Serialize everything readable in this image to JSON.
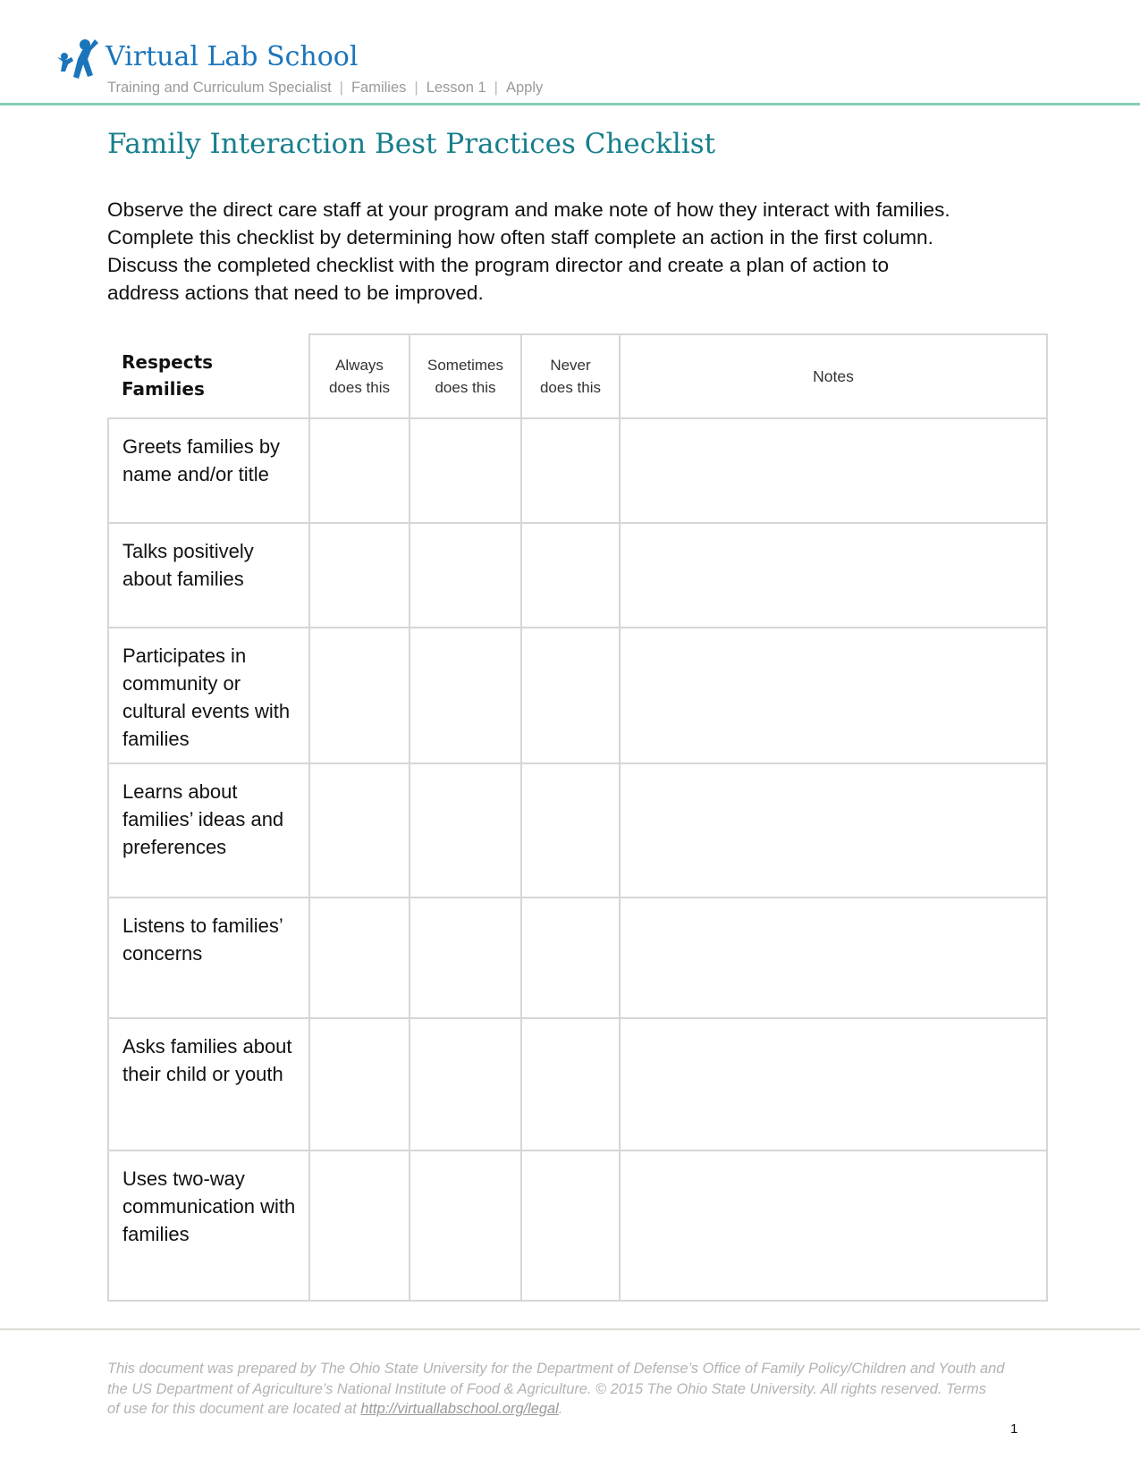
{
  "header": {
    "brand_name": "Virtual Lab School",
    "logo_icon": "people-jumping-icon",
    "breadcrumb": [
      "Training and Curriculum Specialist",
      "Families",
      "Lesson 1",
      "Apply"
    ],
    "breadcrumb_separator": "|"
  },
  "document": {
    "title": "Family Interaction Best Practices Checklist",
    "intro_lines": [
      "Observe the direct care staff at your program and make note of how they interact with families.",
      "Complete this checklist by determining how often staff complete an action in the first column.",
      "Discuss the completed checklist with the program director and create a plan of action to",
      "address actions that need to be improved."
    ]
  },
  "checklist": {
    "section_heading": "Respects Families",
    "columns": {
      "always": [
        "Always",
        "does this"
      ],
      "sometimes": [
        "Sometimes",
        "does this"
      ],
      "never": [
        "Never",
        "does this"
      ],
      "notes": "Notes"
    },
    "rows": [
      {
        "label": "Greets families by name and/or title",
        "always": "",
        "sometimes": "",
        "never": "",
        "notes": ""
      },
      {
        "label": "Talks positively about families",
        "always": "",
        "sometimes": "",
        "never": "",
        "notes": ""
      },
      {
        "label": "Participates in community or cultural events with families",
        "always": "",
        "sometimes": "",
        "never": "",
        "notes": ""
      },
      {
        "label": "Learns about families’ ideas and preferences",
        "always": "",
        "sometimes": "",
        "never": "",
        "notes": ""
      },
      {
        "label": "Listens to families’ concerns",
        "always": "",
        "sometimes": "",
        "never": "",
        "notes": ""
      },
      {
        "label": "Asks families about their child or youth",
        "always": "",
        "sometimes": "",
        "never": "",
        "notes": ""
      },
      {
        "label": "Uses two-way communication with families",
        "always": "",
        "sometimes": "",
        "never": "",
        "notes": ""
      }
    ]
  },
  "footer": {
    "note_line1": "This document was prepared by The Ohio State University for the Department of Defense’s Office of Family Policy/Children and Youth and",
    "note_line2": "the US Department of Agriculture’s National Institute of Food & Agriculture.  © 2015  The Ohio State University.  All rights reserved.  Terms",
    "note_line3_prefix": "of use for this document are located at ",
    "legal_link": "http://virtuallabschool.org/legal",
    "note_line3_suffix": ".",
    "page_number": "1"
  },
  "colors": {
    "brand_blue": "#1b75bb",
    "title_teal": "#177f8c",
    "header_rule": "#85cfb3",
    "table_border": "#d6d6d6",
    "footer_text": "#b3b3b3"
  }
}
